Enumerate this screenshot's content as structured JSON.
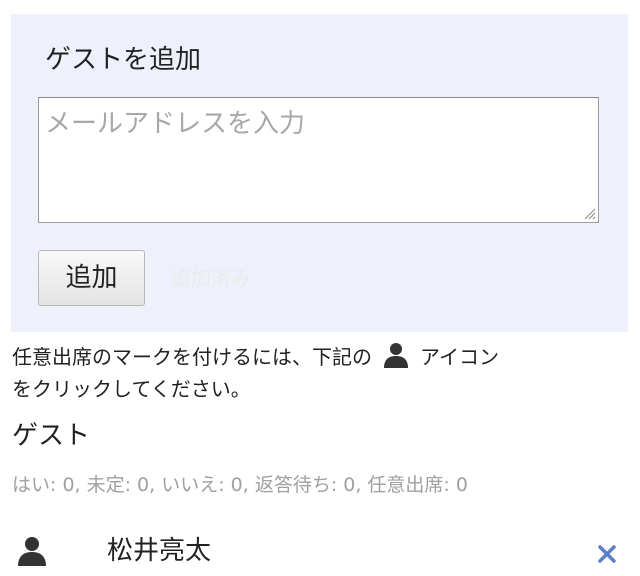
{
  "add_guest": {
    "title": "ゲストを追加",
    "email_placeholder": "メールアドレスを入力",
    "email_value": "",
    "add_button_label": "追加",
    "status_hint": "追加済み"
  },
  "optional_note": {
    "before_icon": "任意出席のマークを付けるには、下記の",
    "after_icon": "アイコン",
    "line2": "をクリックしてください。",
    "icon": "person-icon"
  },
  "guests": {
    "heading": "ゲスト",
    "summary": "はい: 0, 未定: 0, いいえ: 0, 返答待ち: 0, 任意出席: 0",
    "list": [
      {
        "name": "松井亮太",
        "icon": "person-icon",
        "remove_icon": "close-icon"
      }
    ]
  },
  "colors": {
    "panel_background": "#eef0fc",
    "remove_icon": "#5b7fc7",
    "person_icon": "#333333"
  }
}
